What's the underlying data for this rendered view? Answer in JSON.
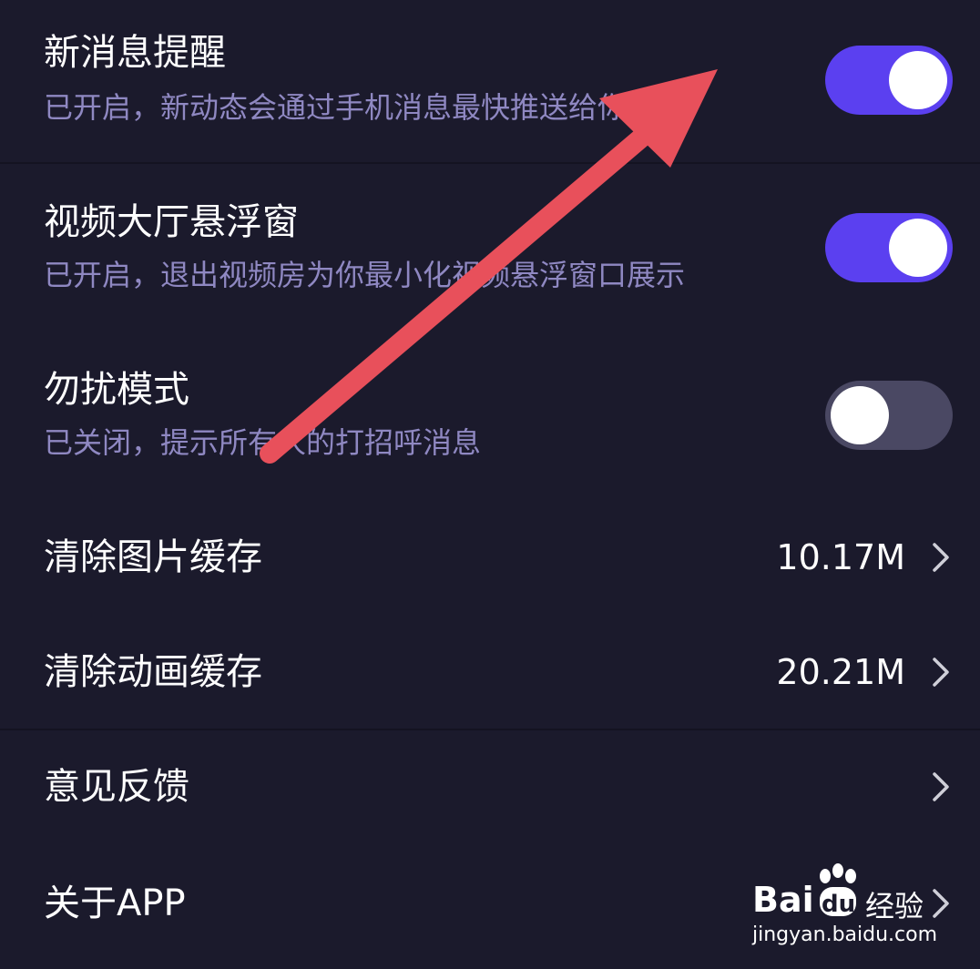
{
  "settings": {
    "new_message": {
      "title": "新消息提醒",
      "subtitle": "已开启，新动态会通过手机消息最快推送给你",
      "enabled": true
    },
    "video_float": {
      "title": "视频大厅悬浮窗",
      "subtitle": "已开启，退出视频房为你最小化视频悬浮窗口展示",
      "enabled": true
    },
    "dnd": {
      "title": "勿扰模式",
      "subtitle": "已关闭，提示所有人的打招呼消息",
      "enabled": false
    },
    "clear_image_cache": {
      "title": "清除图片缓存",
      "value": "10.17M"
    },
    "clear_anim_cache": {
      "title": "清除动画缓存",
      "value": "20.21M"
    },
    "feedback": {
      "title": "意见反馈"
    },
    "about": {
      "title": "关于APP"
    }
  },
  "watermark": {
    "brand": "Bai",
    "brand_du": "du",
    "brand_cn": "经验",
    "url": "jingyan.baidu.com"
  },
  "colors": {
    "background": "#1b1a2c",
    "toggle_on": "#5b40f0",
    "toggle_off": "#4a4863",
    "subtitle": "#8f88c2",
    "annotation_arrow": "#e8505b"
  },
  "icons": {
    "chevron": "chevron-right-icon",
    "annotation": "red-arrow-annotation",
    "watermark_logo": "baidu-paw-icon"
  }
}
